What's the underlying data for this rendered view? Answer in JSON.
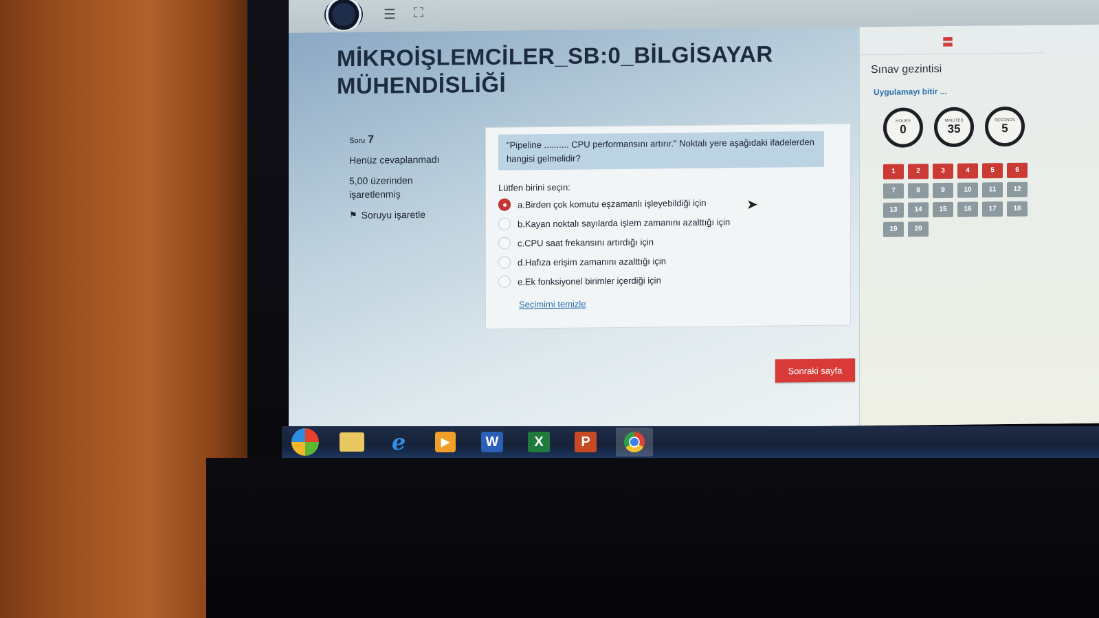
{
  "header": {
    "menu_icon": "hamburger-menu-icon",
    "fullscreen_icon": "fullscreen-icon"
  },
  "main": {
    "title": "MİKROİŞLEMCİLER_SB:0_BİLGİSAYAR MÜHENDİSLİĞİ",
    "question_info": {
      "label": "Soru",
      "number": "7",
      "status": "Henüz cevaplanmadı",
      "marked_out_of": "5,00 üzerinden işaretlenmiş",
      "flag_label": "Soruyu işaretle"
    },
    "question": {
      "text": "\"Pipeline .......... CPU performansını artırır.\" Noktalı yere aşağıdaki ifadelerden hangisi gelmelidir?",
      "prompt": "Lütfen birini seçin:",
      "options": [
        {
          "label": "a.Birden çok komutu eşzamanlı işleyebildiği için",
          "selected": true
        },
        {
          "label": "b.Kayan noktalı sayılarda işlem zamanını azalttığı için",
          "selected": false
        },
        {
          "label": "c.CPU saat frekansını artırdığı için",
          "selected": false
        },
        {
          "label": "d.Hafıza erişim zamanını azalttığı için",
          "selected": false
        },
        {
          "label": "e.Ek fonksiyonel birimler içerdiği için",
          "selected": false
        }
      ],
      "clear_label": "Seçimimi temizle"
    },
    "next_button": "Sonraki sayfa"
  },
  "drawer": {
    "title": "Sınav gezintisi",
    "finish_link": "Uygulamayı bitir ...",
    "timer": {
      "hours_label": "HOURS",
      "hours": "0",
      "minutes_label": "MINUTES",
      "minutes": "35",
      "seconds_label": "SECONDS",
      "seconds": "5"
    },
    "questions": [
      {
        "n": "1",
        "state": "answered"
      },
      {
        "n": "2",
        "state": "answered"
      },
      {
        "n": "3",
        "state": "answered"
      },
      {
        "n": "4",
        "state": "answered"
      },
      {
        "n": "5",
        "state": "answered"
      },
      {
        "n": "6",
        "state": "answered"
      },
      {
        "n": "7",
        "state": "unanswered"
      },
      {
        "n": "8",
        "state": "unanswered"
      },
      {
        "n": "9",
        "state": "unanswered"
      },
      {
        "n": "10",
        "state": "unanswered"
      },
      {
        "n": "11",
        "state": "unanswered"
      },
      {
        "n": "12",
        "state": "unanswered"
      },
      {
        "n": "13",
        "state": "unanswered"
      },
      {
        "n": "14",
        "state": "unanswered"
      },
      {
        "n": "15",
        "state": "unanswered"
      },
      {
        "n": "16",
        "state": "unanswered"
      },
      {
        "n": "17",
        "state": "unanswered"
      },
      {
        "n": "18",
        "state": "unanswered"
      },
      {
        "n": "19",
        "state": "unanswered"
      },
      {
        "n": "20",
        "state": "unanswered"
      }
    ]
  },
  "taskbar": {
    "apps": [
      "start-icon",
      "file-explorer-icon",
      "internet-explorer-icon",
      "media-player-icon",
      "word-icon",
      "excel-icon",
      "powerpoint-icon",
      "chrome-icon"
    ],
    "ie_glyph": "e",
    "media_glyph": "▶",
    "word_glyph": "W",
    "excel_glyph": "X",
    "ppt_glyph": "P"
  },
  "colors": {
    "accent_red": "#d93a38",
    "link_blue": "#2a6fb0",
    "question_bg": "#bcd3e3"
  }
}
